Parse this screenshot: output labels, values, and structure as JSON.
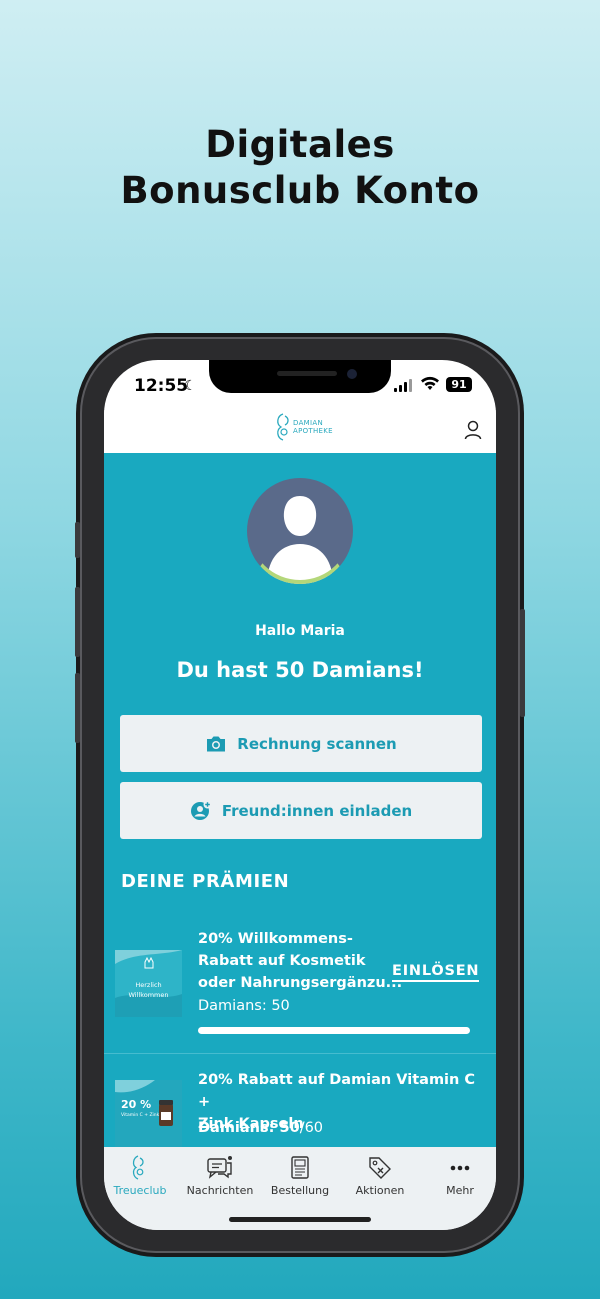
{
  "headline": {
    "line1": "Digitales",
    "line2": "Bonusclub Konto"
  },
  "status_bar": {
    "time": "12:55",
    "battery": "91"
  },
  "app": {
    "logo_line1": "DAMIAN",
    "logo_line2": "APOTHEKE"
  },
  "greeting": "Hallo Maria",
  "points_text": "Du hast 50 Damians!",
  "buttons": {
    "scan": "Rechnung scannen",
    "invite": "Freund:innen einladen"
  },
  "rewards_section_title": "DEINE PRÄMIEN",
  "rewards": [
    {
      "title_line1": "20% Willkommens-",
      "title_line2": "Rabatt auf Kosmetik",
      "title_line3": "oder Nahrungsergänzu...",
      "damians_label": "Damians: 50",
      "action": "EINLÖSEN",
      "thumb_line1": "Herzlich",
      "thumb_line2": "Willkommen",
      "progress": 1.0
    },
    {
      "title_line1": "20% Rabatt auf Damian Vitamin C +",
      "title_line2": "Zink Kapseln",
      "damians_prefix": "Damians: ",
      "damians_current": "50",
      "damians_total": "/60",
      "thumb_line1": "20 %",
      "thumb_line2": "Vitamin C + Zink",
      "progress": 0.8333
    }
  ],
  "tabs": [
    {
      "label": "Treueclub",
      "icon": "treueclub-logo-icon",
      "active": true
    },
    {
      "label": "Nachrichten",
      "icon": "chat-icon",
      "active": false
    },
    {
      "label": "Bestellung",
      "icon": "prescription-icon",
      "active": false
    },
    {
      "label": "Aktionen",
      "icon": "tag-icon",
      "active": false
    },
    {
      "label": "Mehr",
      "icon": "more-icon",
      "active": false
    }
  ],
  "colors": {
    "brand_teal": "#19a9c0",
    "button_bg": "#edf1f3",
    "button_text": "#1c9bb3"
  }
}
